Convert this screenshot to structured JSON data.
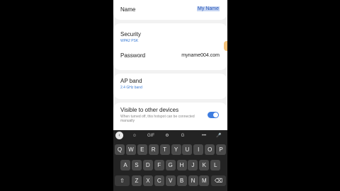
{
  "settings": {
    "name": {
      "label": "Name",
      "value": "My Name"
    },
    "security": {
      "label": "Security",
      "value": "WPA2 PSK"
    },
    "password": {
      "label": "Password",
      "value": "myname004.com"
    },
    "ap_band": {
      "label": "AP band",
      "value": "2.4 GHz band"
    },
    "visible": {
      "label": "Visible to other devices",
      "description": "When turned off, this hotspot can be connected manually",
      "enabled": true
    }
  },
  "keyboard": {
    "toolbar": {
      "back": "‹",
      "sticker": "☺",
      "gif": "GIF",
      "settings": "⚙",
      "translate": "G",
      "more": "•••",
      "mic": "🎤"
    },
    "row1": [
      "Q",
      "W",
      "E",
      "R",
      "T",
      "Y",
      "U",
      "I",
      "O",
      "P"
    ],
    "row2": [
      "A",
      "S",
      "D",
      "F",
      "G",
      "H",
      "J",
      "K",
      "L"
    ],
    "row3": [
      "Z",
      "X",
      "C",
      "V",
      "B",
      "N",
      "M"
    ],
    "shift": "⇧",
    "backspace": "⌫"
  },
  "colors": {
    "accent": "#3d7ce0",
    "link": "#3a7bd5",
    "keyboard_bg": "#232323",
    "key_bg": "#4a4a4a"
  }
}
